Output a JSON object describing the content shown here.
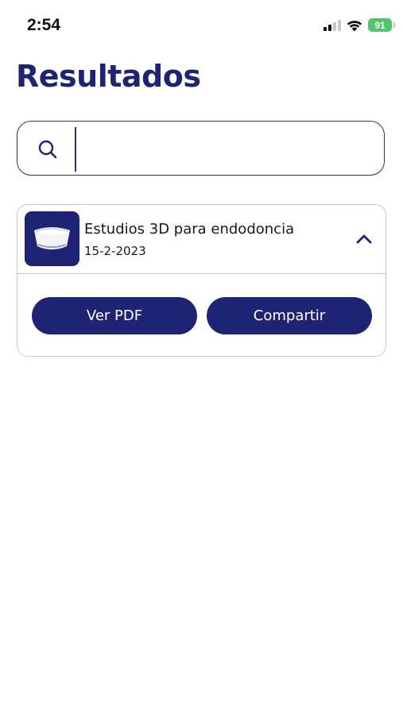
{
  "status_bar": {
    "time": "2:54",
    "battery": "91",
    "icons": [
      "signal-icon",
      "wifi-icon",
      "battery-icon"
    ]
  },
  "page": {
    "title": "Resultados"
  },
  "search": {
    "value": "",
    "placeholder": "",
    "icon": "search-icon"
  },
  "results": [
    {
      "title": "Estudios 3D para endodoncia",
      "date": "15-2-2023",
      "thumbnail": "dental-scan-thumbnail",
      "expanded": true,
      "actions": {
        "view_pdf": "Ver PDF",
        "share": "Compartir"
      }
    }
  ],
  "colors": {
    "primary": "#1f2373",
    "border": "#c8c8cc",
    "battery": "#4fc66a"
  }
}
